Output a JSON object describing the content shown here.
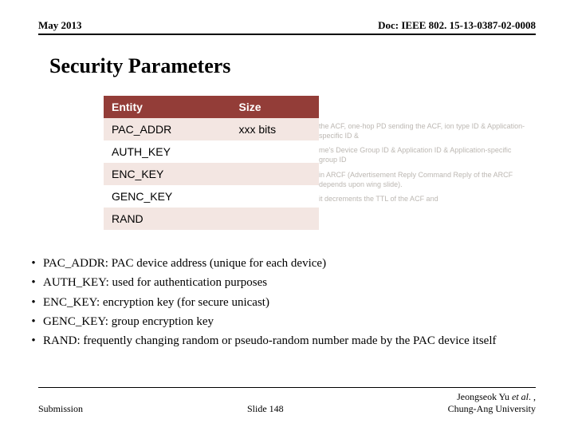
{
  "header": {
    "left": "May 2013",
    "right": "Doc: IEEE 802. 15-13-0387-02-0008"
  },
  "title": "Security Parameters",
  "table": {
    "columns": [
      "Entity",
      "Size"
    ],
    "rows": [
      {
        "entity": "PAC_ADDR",
        "size": "xxx bits"
      },
      {
        "entity": "AUTH_KEY",
        "size": ""
      },
      {
        "entity": "ENC_KEY",
        "size": ""
      },
      {
        "entity": "GENC_KEY",
        "size": ""
      },
      {
        "entity": "RAND",
        "size": ""
      }
    ]
  },
  "ghost": {
    "p1": "the ACF, one-hop PD sending the ACF, ion type ID & Application-specific ID &",
    "p2": "me's Device Group ID & Application ID & Application-specific group ID",
    "p3": "in ARCF (Advertisement Reply Command  Reply of the ARCF depends upon  wing slide).",
    "p4": "it decrements the TTL of the ACF and"
  },
  "bullets": [
    "PAC_ADDR: PAC device address (unique for each device)",
    "AUTH_KEY: used for authentication purposes",
    "ENC_KEY: encryption key (for secure unicast)",
    "GENC_KEY: group encryption key",
    "RAND: frequently changing random or pseudo-random number made by the PAC device itself"
  ],
  "footer": {
    "left": "Submission",
    "center": "Slide 148",
    "right_line1": "Jeongseok Yu ",
    "right_etal": "et al",
    "right_line1_tail": ". ,",
    "right_line2": "Chung-Ang University"
  }
}
